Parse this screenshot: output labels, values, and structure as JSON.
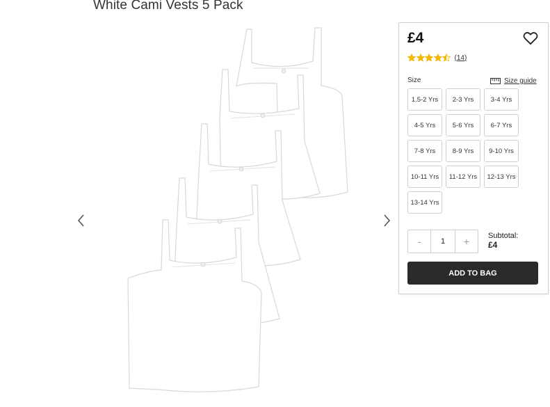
{
  "product": {
    "title": "White Cami Vests 5 Pack"
  },
  "buy": {
    "price": "£4",
    "rating": 4.5,
    "reviews": "(14)",
    "size_label": "Size",
    "size_guide": "Size guide",
    "sizes": [
      "1.5-2 Yrs",
      "2-3 Yrs",
      "3-4 Yrs",
      "4-5 Yrs",
      "5-6 Yrs",
      "6-7 Yrs",
      "7-8 Yrs",
      "8-9 Yrs",
      "9-10 Yrs",
      "10-11 Yrs",
      "11-12 Yrs",
      "12-13 Yrs",
      "13-14 Yrs"
    ],
    "qty_minus": "-",
    "qty_value": "1",
    "qty_plus": "+",
    "subtotal_label": "Subtotal:",
    "subtotal_value": "£4",
    "add_to_bag": "ADD TO BAG"
  },
  "colors": {
    "star": "#f5b800",
    "button": "#2a2a2a"
  }
}
